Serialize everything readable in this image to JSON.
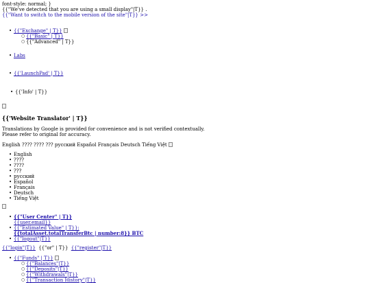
{
  "top": {
    "css_leak": "font-style: normal; }",
    "small_display_notice": "{{\"We've detected that you are using a small display\"|T}} .",
    "mobile_switch_link": "{{\"Want to switch to the mobile version of the site\"|T}} >>"
  },
  "nav": {
    "exchange": "{{\"Exchange\" | T}}",
    "basic": "{{\"Basic\" | T}}",
    "advanced": "{{\"Advanced\" | T}}",
    "labs": "Labs",
    "launchpad": "{{'LaunchPad' | T}}",
    "info": "{{'Info' | T}}"
  },
  "translator": {
    "heading": "{{'Website Translator' | T}}",
    "disclaimer_line1": "Translations by Google is provided for convenience and is not verified contextually.",
    "disclaimer_line2": "Please refer to original for accuracy.",
    "inline_languages": "English ???? ???? ??? русский Español Français Deutsch Tiếng Việt",
    "languages": [
      "English",
      "????",
      "????",
      "???",
      "русский",
      "Español",
      "Français",
      "Deutsch",
      "Tiếng Việt"
    ]
  },
  "account": {
    "user_center": "{{\"User Center\" | T}}",
    "user_email": "{{user.email}}",
    "estimated_value": "{{\"Estimated Value\" | T}}:",
    "total_value": "{{totalAsset.totalTransferBtc | number:8}} BTC",
    "logout": "{{\"logout\"|T}}"
  },
  "auth": {
    "login": "{{\"login\"|T}}",
    "or": "{{\"or\" | T}}",
    "register": "{{\"register\"|T}}"
  },
  "funds": {
    "funds": "{{\"Funds\" | T}}",
    "balances": "{{\"Balances\"|T}}",
    "deposits": "{{\"Deposits\"|T}}",
    "withdrawals": "{{\"Withdrawals\"|T}}",
    "history": "{{\"Transaction History\"|T}}"
  }
}
